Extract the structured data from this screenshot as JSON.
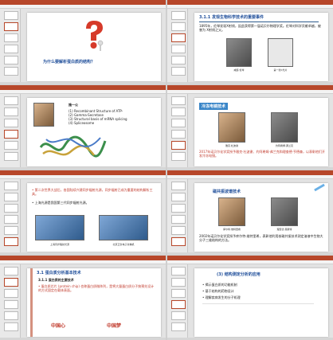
{
  "slides": {
    "s1": {
      "question": "为什么要解析蛋白质的结构？"
    },
    "s2": {
      "heading": "3.1.1 发现生物科学技术的重要事件",
      "body": "1895年，伦琴发现X射线，因此获得第一届诺贝尔物理学奖。伦琴对科学贡献卓越，被誉为 X射线之父。",
      "caption_left": "威廉·伦琴",
      "caption_right": "第一张X光片"
    },
    "s3": {
      "name": "施一公",
      "line1": "(1) Recombinant Structure of ATP-",
      "line2": "(2) Gamma-Secretase",
      "line3": "(3) Structural basis of mRNA splicing",
      "line4": "(4) Spliceosome"
    },
    "s4": {
      "banner": "冷冻电镜技术",
      "caption_left": "雅克·杜波谢",
      "caption_right": "约阿希姆·弗兰克",
      "body": "2017年诺贝尔化学奖授予雅克·杜波谢、约阿希姆·弗兰克和理查德·亨德森，以表彰他们开发冷冻电镜。"
    },
    "s5": {
      "line1": "• 第二次世界大战后，各国陆续兴建同步辐射光源，同步辐射已成为重要的结构解析工具。",
      "line2": "• 上海光源是我国第三代同步辐射光源。",
      "cap_left": "上海同步辐射光源",
      "cap_right": "北京正负电子对撞机"
    },
    "s6": {
      "banner": "磁共振波谱技术",
      "cap_left": "库尔特·维特里希",
      "cap_right": "理查德·恩斯特",
      "body": "2002年诺贝尔化学奖授予库尔特·维特里希，表彰他利用核磁共振技术测定溶液中生物大分子三维结构的方法。"
    },
    "s7": {
      "heading": "3.1 蛋白质分析基本技术",
      "sub": "3.1.1 蛋白质的主要技术",
      "body": "• 蛋白质芯片 (protein chip) 也称蛋白质微阵列，是将大量蛋白质分子按预先设计的方式固定在载体表面。",
      "foot_left": "中国心",
      "foot_right": "中国梦"
    },
    "s8": {
      "heading": "(3) 结构测定分析的应用",
      "body1": "• 揭示蛋白质的功能机制",
      "body2": "• 基于结构的药物设计",
      "body3": "• 理解疾病发生的分子机理"
    }
  }
}
